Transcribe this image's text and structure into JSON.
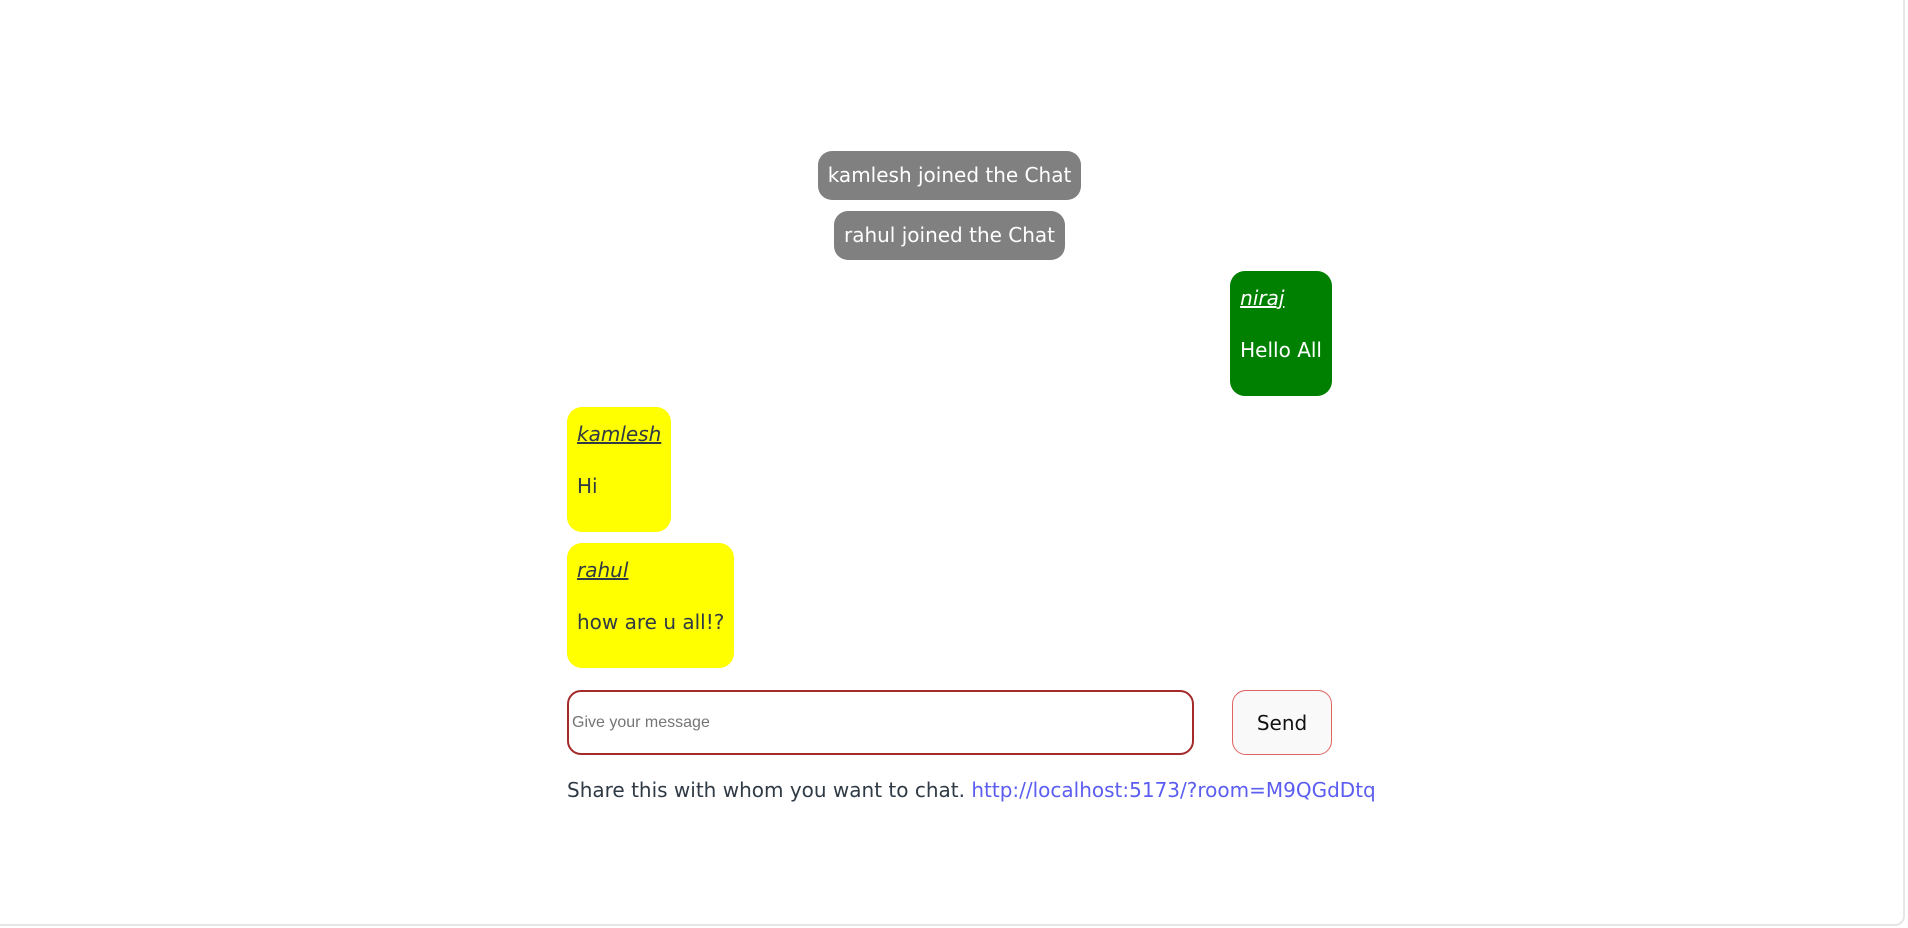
{
  "system_messages": [
    "kamlesh joined the Chat",
    "rahul joined the Chat"
  ],
  "messages": [
    {
      "sender": "niraj",
      "text": "Hello All",
      "side": "right",
      "color": "#008000"
    },
    {
      "sender": "kamlesh",
      "text": "Hi",
      "side": "left",
      "color": "#ffff00"
    },
    {
      "sender": "rahul",
      "text": "how are u all!?",
      "side": "left",
      "color": "#ffff00"
    }
  ],
  "composer": {
    "placeholder": "Give your message",
    "value": "",
    "send_label": "Send"
  },
  "share": {
    "text": "Share this with whom you want to chat.",
    "link": "http://localhost:5173/?room=M9QGdDtq"
  },
  "colors": {
    "system_bubble": "#808080",
    "own_bubble": "#008000",
    "other_bubble": "#ffff00",
    "link": "#5b5ef0",
    "input_border": "#a52a2a"
  }
}
